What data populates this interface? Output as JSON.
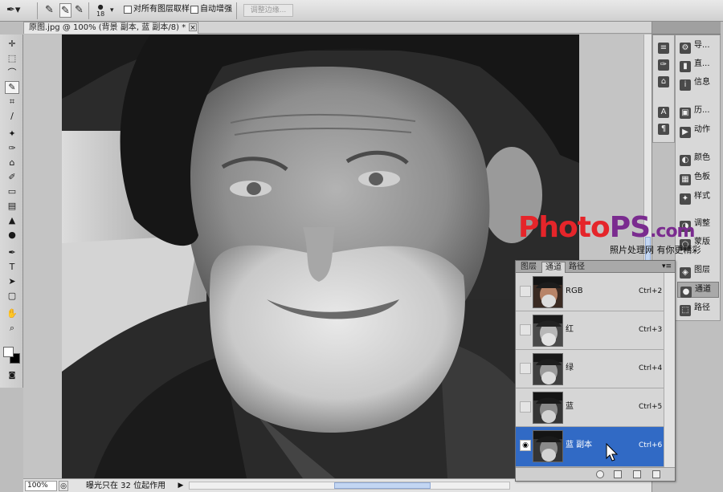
{
  "options_bar": {
    "sample_all_layers": "对所有图层取样",
    "auto_enhance": "自动增强",
    "refine_edge": "调整边缘...",
    "brush_size": "18"
  },
  "document": {
    "tab_title": "原图.jpg @ 100% (背景 副本, 蓝 副本/8) *",
    "close_symbol": "×"
  },
  "status_bar": {
    "zoom": "100%",
    "message": "曝光只在 32 位起作用"
  },
  "right_dock": {
    "collapsed_panels": [
      "导...",
      "直...",
      "信息",
      "历...",
      "动作",
      "颜色",
      "色板",
      "样式",
      "调整",
      "蒙版",
      "图层",
      "通道",
      "路径"
    ]
  },
  "watermark": {
    "logo_text": [
      "P",
      "h",
      "o",
      "t",
      "o",
      "P",
      "S"
    ],
    "domain": ".com",
    "tagline": "照片处理网 有你更精彩"
  },
  "channels_panel": {
    "tabs": [
      "图层",
      "通道",
      "路径"
    ],
    "active_tab": "通道",
    "rows": [
      {
        "name": "RGB",
        "shortcut": "Ctrl+2",
        "visible": false,
        "selected": false
      },
      {
        "name": "红",
        "shortcut": "Ctrl+3",
        "visible": false,
        "selected": false
      },
      {
        "name": "绿",
        "shortcut": "Ctrl+4",
        "visible": false,
        "selected": false
      },
      {
        "name": "蓝",
        "shortcut": "Ctrl+5",
        "visible": false,
        "selected": false
      },
      {
        "name": "蓝 副本",
        "shortcut": "Ctrl+6",
        "visible": true,
        "selected": true
      }
    ]
  },
  "colors": {
    "selection": "#316ac5",
    "logo_red": "#e5252a",
    "logo_purple": "#7a2b8f"
  }
}
